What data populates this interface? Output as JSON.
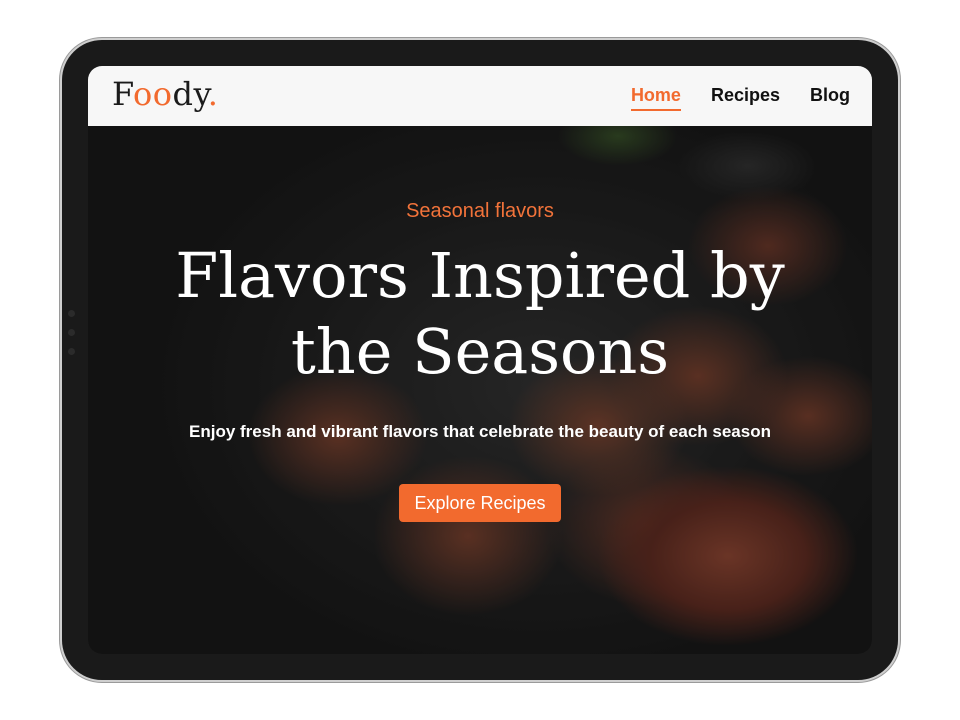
{
  "brand": {
    "prefix": "F",
    "oo": "oo",
    "suffix": "dy",
    "dot": "."
  },
  "nav": {
    "items": [
      {
        "label": "Home",
        "active": true
      },
      {
        "label": "Recipes",
        "active": false
      },
      {
        "label": "Blog",
        "active": false
      }
    ]
  },
  "hero": {
    "eyebrow": "Seasonal flavors",
    "headline": "Flavors Inspired by the Seasons",
    "subtitle": "Enjoy fresh and vibrant flavors that celebrate the beauty of each season",
    "cta_label": "Explore Recipes"
  },
  "colors": {
    "accent": "#f26a2e",
    "nav_bg": "#f7f7f7",
    "frame": "#1a1a1a"
  }
}
